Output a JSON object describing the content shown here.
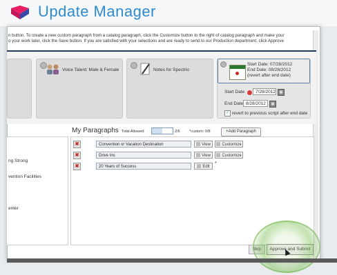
{
  "app": {
    "title": "Update Manager",
    "brand_color": "#2e8bd0"
  },
  "instructions": {
    "line1": "n button. To create a new custom paragraph from a catalog paragraph, click the Customize button to the right of catalog paragraph and make your",
    "line2": "o your work later, click the Save button. If you are satisfied with your selections and are ready to send to our Production department, click Approve"
  },
  "tiles": [
    {
      "label": "Voice Talent: Male & Female",
      "icon": "people-icon"
    },
    {
      "label": "Notes for Spectrio",
      "icon": "pencil-icon"
    }
  ],
  "schedule": {
    "start_text": "Start Date: 07/28/2012",
    "end_text": "End Date: 08/28/2012",
    "revert_text": "(revert after end date)",
    "start_label": "Start Date",
    "start_value": "7/28/2012",
    "end_label": "End Date",
    "end_value": "8/28/2012",
    "revert_checkbox_label": "revert to previous script after end date"
  },
  "left_list": [
    "ng Strong",
    "vention Facilities",
    "enter"
  ],
  "my_paragraphs": {
    "title": "My Paragraphs",
    "total_allowed_label": "Total Allowed:",
    "progress_fraction": 0.5,
    "count": "2/6",
    "custom_count": "*custom: 0/8",
    "add_button": "Add Paragraph",
    "rows": [
      {
        "name": "Convention or Vacation Destination",
        "view": "View",
        "customize": "Customize"
      },
      {
        "name": "Drive Ins",
        "view": "View",
        "customize": "Customize"
      },
      {
        "name": "20 Years of Success",
        "edit": "Edit",
        "marker": "*"
      }
    ]
  },
  "footer": {
    "skip": "Skip",
    "submit": "Approve and Submit"
  }
}
